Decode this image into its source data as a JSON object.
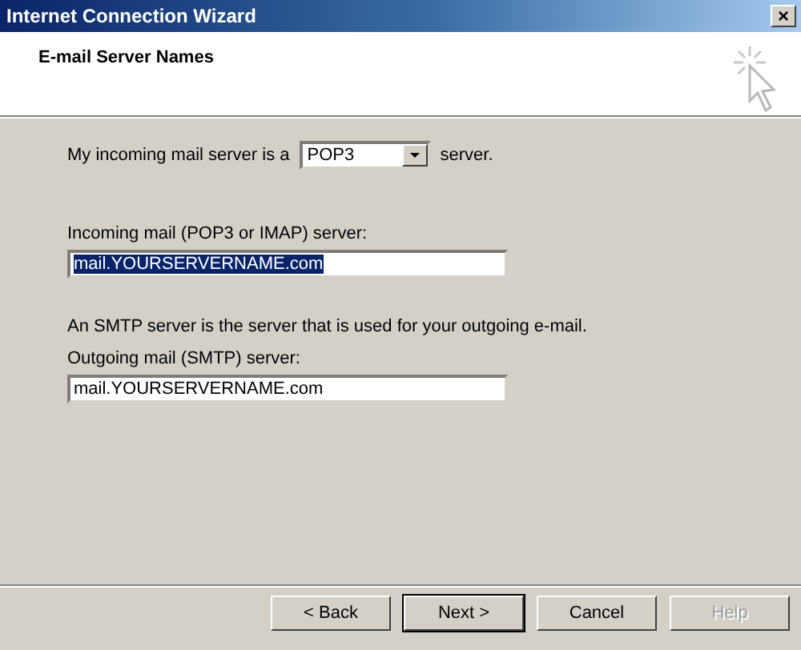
{
  "window": {
    "title": "Internet Connection Wizard",
    "close": "×"
  },
  "header": {
    "title": "E-mail Server Names"
  },
  "server_type": {
    "label": "My incoming mail server is a",
    "value": "POP3",
    "suffix": "server."
  },
  "incoming": {
    "label": "Incoming mail (POP3 or IMAP) server:",
    "value": "mail.YOURSERVERNAME.com",
    "selected": true
  },
  "smtp_note": "An SMTP server is the server that is used for your outgoing e-mail.",
  "outgoing": {
    "label": "Outgoing mail (SMTP) server:",
    "value": "mail.YOURSERVERNAME.com",
    "selected": false
  },
  "buttons": [
    {
      "label": "< Back",
      "default": false,
      "disabled": false
    },
    {
      "label": "Next >",
      "default": true,
      "disabled": false
    },
    {
      "label": "Cancel",
      "default": false,
      "disabled": false
    },
    {
      "label": "Help",
      "default": false,
      "disabled": true
    }
  ]
}
